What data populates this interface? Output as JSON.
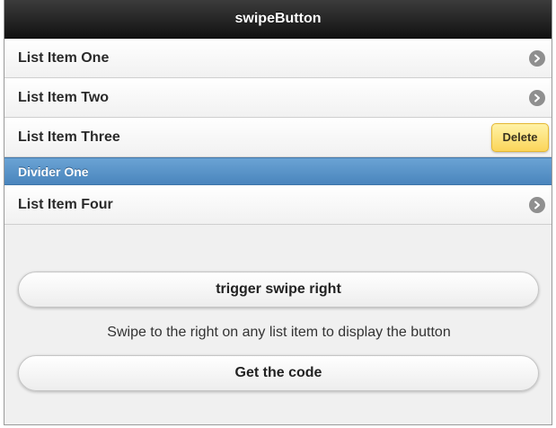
{
  "header": {
    "title": "swipeButton"
  },
  "list": {
    "items": [
      {
        "label": "List Item One",
        "icon": "chevron-right-icon"
      },
      {
        "label": "List Item Two",
        "icon": "chevron-right-icon"
      },
      {
        "label": "List Item Three",
        "action_label": "Delete"
      },
      {
        "label": "List Item Four",
        "icon": "chevron-right-icon"
      }
    ],
    "divider": {
      "label": "Divider One"
    }
  },
  "content": {
    "swipe_button_label": "trigger swipe right",
    "hint_text": "Swipe to the right on any list item to display the button",
    "code_button_label": "Get the code"
  },
  "colors": {
    "header_bg": "#1a1a1a",
    "divider_bg": "#5a94c9",
    "delete_button": "#fbd55a",
    "arrow_icon": "#8f8f8f"
  }
}
